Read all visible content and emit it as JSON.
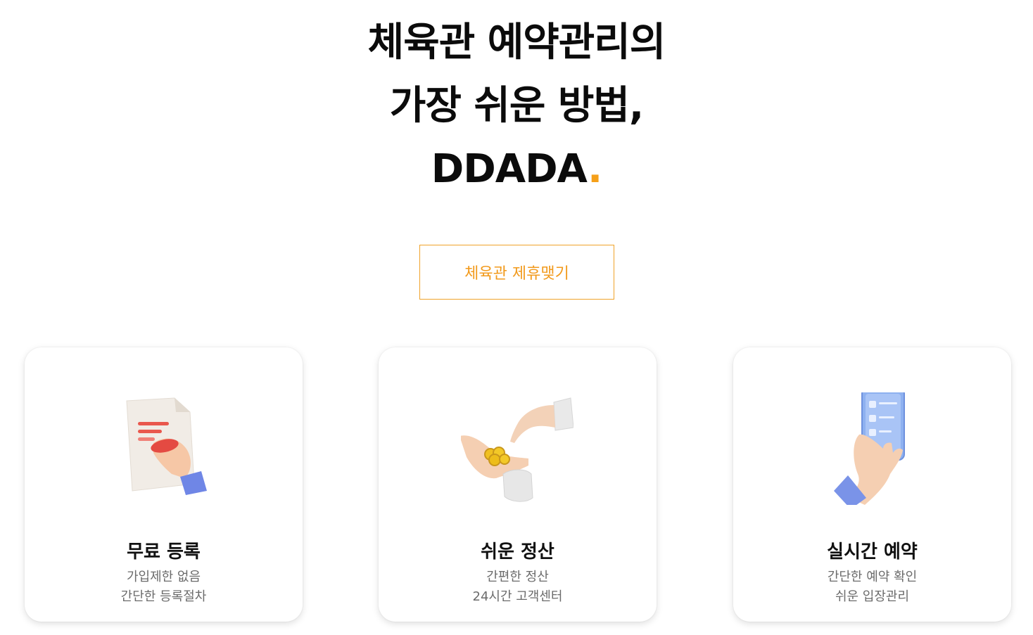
{
  "hero": {
    "line1": "체육관 예약관리의",
    "line2": "가장 쉬운 방법,",
    "brand": "DDADA",
    "brand_dot": ".",
    "accent_color": "#f5a019"
  },
  "cta": {
    "label": "체육관 제휴맺기"
  },
  "cards": [
    {
      "icon": "document-signing-hand-icon",
      "title": "무료 등록",
      "lines": [
        "가입제한 없음",
        "간단한 등록절차"
      ]
    },
    {
      "icon": "coins-in-hand-icon",
      "title": "쉬운 정산",
      "lines": [
        "간편한 정산",
        "24시간 고객센터"
      ]
    },
    {
      "icon": "phone-checklist-hand-icon",
      "title": "실시간 예약",
      "lines": [
        "간단한 예약 확인",
        "쉬운 입장관리"
      ]
    }
  ]
}
